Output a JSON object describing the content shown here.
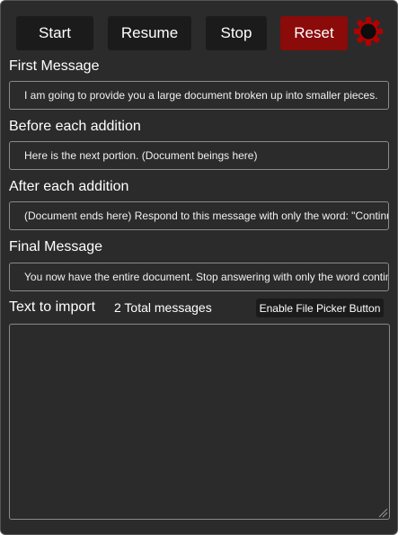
{
  "toolbar": {
    "start_label": "Start",
    "resume_label": "Resume",
    "stop_label": "Stop",
    "reset_label": "Reset",
    "reset_color": "#8b0a0a",
    "settings_icon": "gear-icon",
    "settings_icon_color": "#b30000"
  },
  "fields": {
    "first_message": {
      "label": "First Message",
      "value": "I am going to provide you a large document broken up into smaller pieces."
    },
    "before_each": {
      "label": "Before each addition",
      "value": "Here is the next portion. (Document beings here)"
    },
    "after_each": {
      "label": "After each addition",
      "value": "(Document ends here) Respond to this message with only the word: \"Continue\""
    },
    "final_message": {
      "label": "Final Message",
      "value": "You now have the entire document. Stop answering with only the word continue."
    }
  },
  "import": {
    "label": "Text to import",
    "count_text": "2 Total messages",
    "picker_button_label": "Enable File Picker Button",
    "text_value": ""
  },
  "colors": {
    "panel_bg": "#2b2b2b",
    "button_bg": "#1b1b1b",
    "field_border": "#8a8a8a"
  }
}
